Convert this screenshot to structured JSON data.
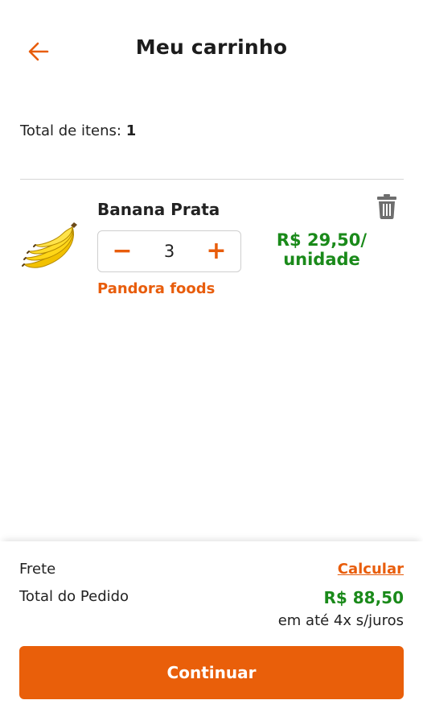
{
  "header": {
    "title": "Meu carrinho",
    "back_icon": "arrow-left-icon"
  },
  "summary": {
    "total_items_label": "Total de itens:",
    "total_items_count": "1"
  },
  "cart": {
    "items": [
      {
        "name": "Banana Prata",
        "quantity": "3",
        "seller": "Pandora foods",
        "price_line1": "R$ 29,50/",
        "price_line2": "unidade",
        "image_icon": "banana-image",
        "remove_icon": "trash-icon",
        "decrement_symbol": "−",
        "increment_symbol": "+"
      }
    ]
  },
  "footer": {
    "freight_label": "Frete",
    "calculate_label": "Calcular",
    "order_total_label": "Total do Pedido",
    "order_total_value": "R$ 88,50",
    "installments": "em até 4x s/juros",
    "continue_label": "Continuar"
  },
  "colors": {
    "accent": "#e95f0a",
    "price_green": "#1a8a1a",
    "text": "#222222",
    "divider": "#d6d6d6"
  }
}
